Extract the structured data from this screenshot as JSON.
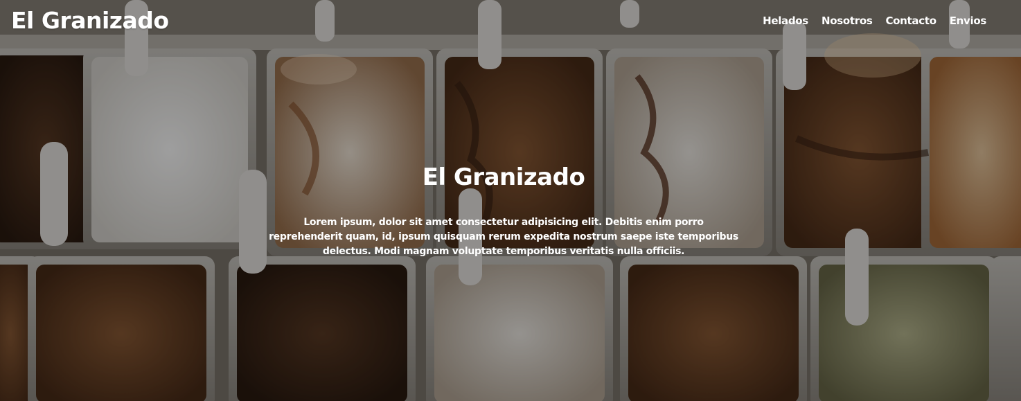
{
  "header": {
    "brand": "El Granizado",
    "nav": [
      "Helados",
      "Nosotros",
      "Contacto",
      "Envios"
    ]
  },
  "hero": {
    "title": "El Granizado",
    "description": "Lorem ipsum, dolor sit amet consectetur adipisicing elit. Debitis enim porro reprehenderit quam, id, ipsum quisquam rerum expedita nostrum saepe iste temporibus delectus. Modi magnam voluptate temporibus veritatis nulla officiis.",
    "background": "ice-cream-display-photo"
  },
  "colors": {
    "text": "#ffffff",
    "overlay": "#000000"
  }
}
